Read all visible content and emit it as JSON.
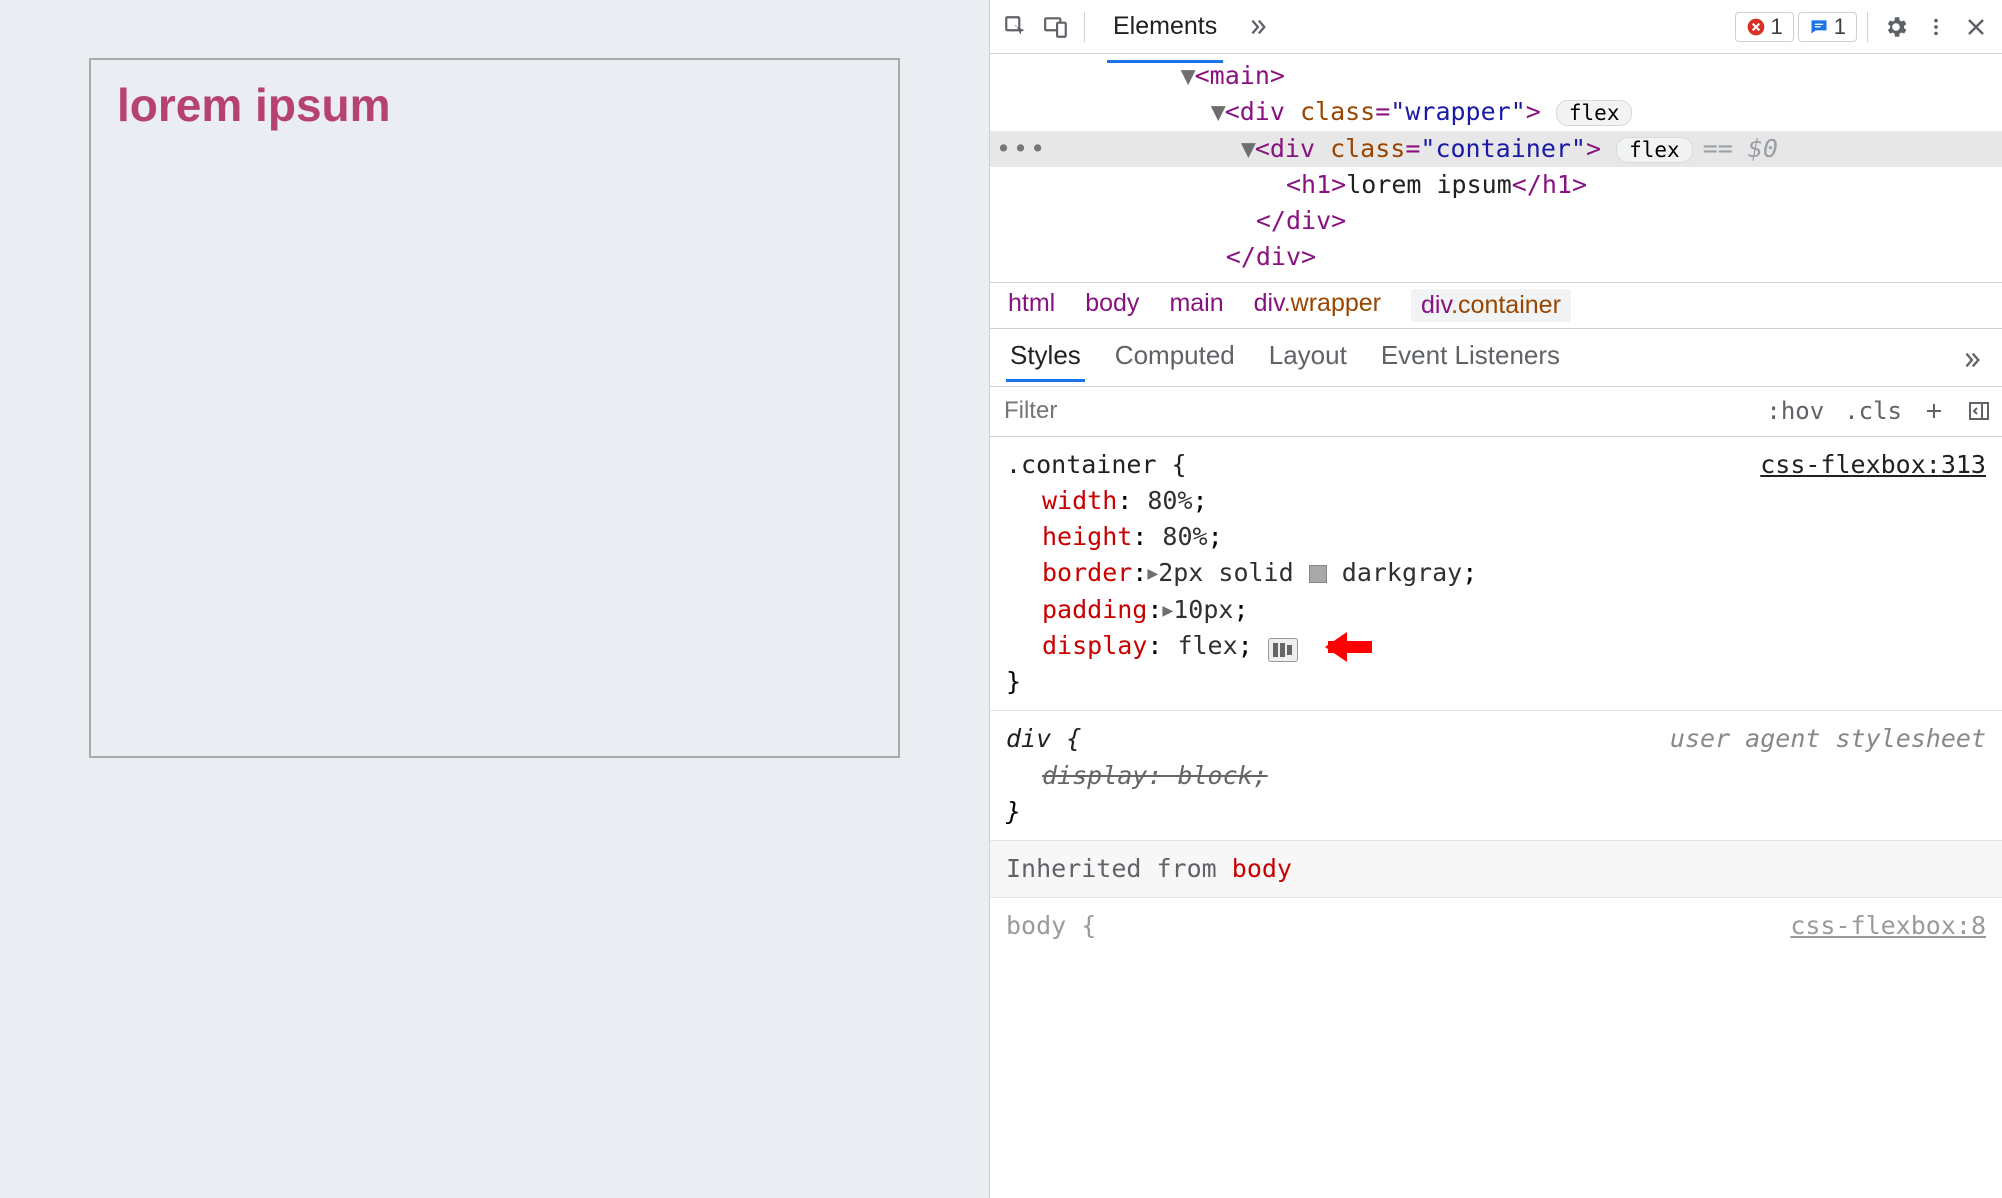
{
  "page": {
    "heading": "lorem ipsum"
  },
  "toolbar": {
    "tabs": {
      "elements": "Elements"
    },
    "error_count": "1",
    "message_count": "1"
  },
  "dom": {
    "main_open": "<main>",
    "wrapper_open": "<div class=\"wrapper\">",
    "wrapper_badge": "flex",
    "container_open": "<div class=\"container\">",
    "container_badge": "flex",
    "selected_marker": "== $0",
    "h1_open": "<h1>",
    "h1_text": "lorem ipsum",
    "h1_close": "</h1>",
    "div_close1": "</div>",
    "div_close2": "</div>"
  },
  "breadcrumb": [
    "html",
    "body",
    "main",
    "div.wrapper",
    "div.container"
  ],
  "subtabs": [
    "Styles",
    "Computed",
    "Layout",
    "Event Listeners"
  ],
  "filter": {
    "placeholder": "Filter",
    "hov": ":hov",
    "cls": ".cls"
  },
  "styles": {
    "rule1": {
      "selector": ".container {",
      "source": "css-flexbox:313",
      "decls": [
        {
          "prop": "width",
          "val": "80%",
          "suffix": ";"
        },
        {
          "prop": "height",
          "val": "80%",
          "suffix": ";"
        },
        {
          "prop": "border",
          "tri": true,
          "val": "2px solid ",
          "swatch": true,
          "val2": "darkgray",
          "suffix": ";"
        },
        {
          "prop": "padding",
          "tri": true,
          "val": "10px",
          "suffix": ";"
        },
        {
          "prop": "display",
          "val": "flex",
          "suffix": ";",
          "flexicon": true,
          "arrow": true
        }
      ],
      "close": "}"
    },
    "rule2": {
      "selector": "div {",
      "source": "user agent stylesheet",
      "decl_strike": "display: block;",
      "close": "}"
    },
    "inherited_label": "Inherited from ",
    "inherited_from": "body",
    "rule3_partial": "body {",
    "rule3_src_partial": "css-flexbox:8"
  }
}
